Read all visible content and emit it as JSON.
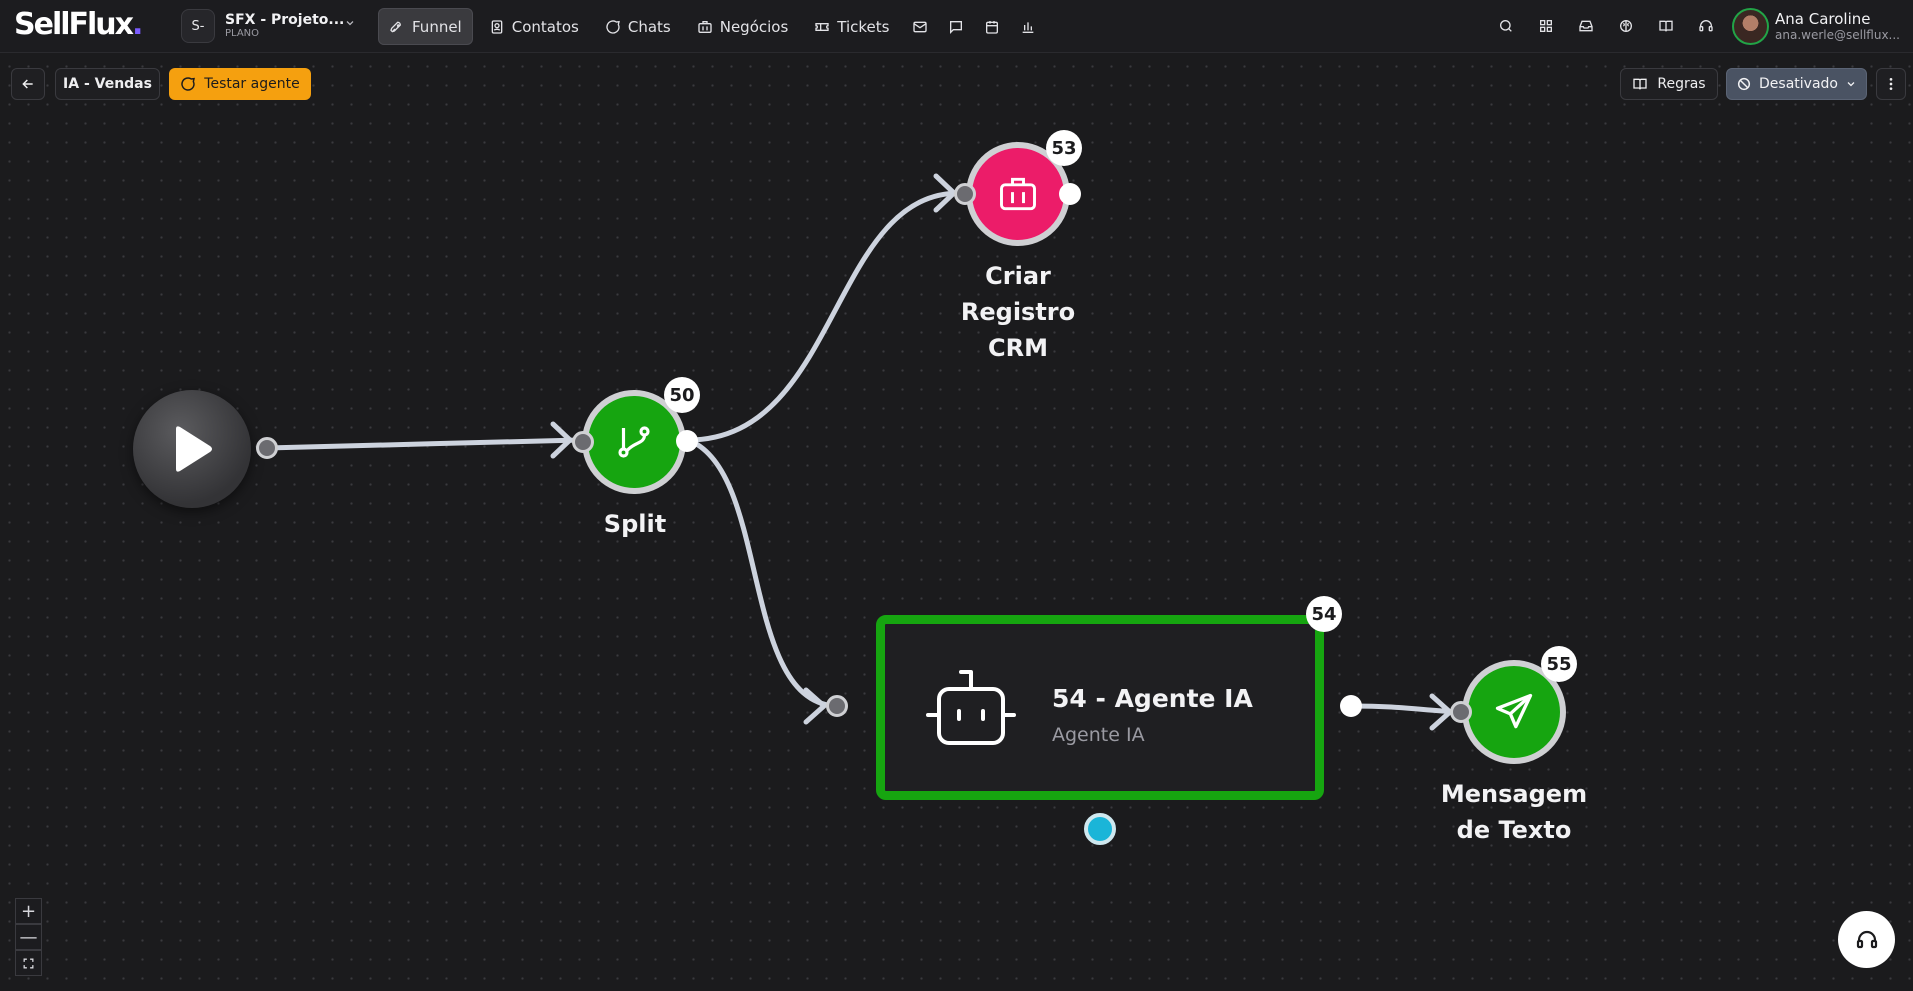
{
  "app": {
    "logo": "SellFlux",
    "logo_dot": "."
  },
  "project": {
    "badge": "S-",
    "name": "SFX - Projeto...",
    "plan": "PLANO"
  },
  "nav": {
    "items": [
      {
        "label": "Funnel",
        "icon": "rocket-icon",
        "active": true
      },
      {
        "label": "Contatos",
        "icon": "contacts-icon"
      },
      {
        "label": "Chats",
        "icon": "chat-bubble-icon"
      },
      {
        "label": "Negócios",
        "icon": "briefcase-icon"
      },
      {
        "label": "Tickets",
        "icon": "ticket-icon"
      }
    ],
    "icon_items": [
      "mail-icon",
      "message-square-icon",
      "calendar-icon",
      "bar-chart-icon"
    ]
  },
  "header_icons": [
    "search-icon",
    "apps-grid-icon",
    "inbox-icon",
    "brain-icon",
    "book-icon",
    "headset-icon"
  ],
  "user": {
    "name": "Ana Caroline",
    "email": "ana.werle@sellflux..."
  },
  "toolbar": {
    "flow_name": "IA - Vendas",
    "test_label": "Testar agente",
    "rules_label": "Regras",
    "status_label": "Desativado"
  },
  "nodes": {
    "split": {
      "number": "50",
      "label": "Split"
    },
    "crm": {
      "number": "53",
      "label_lines": [
        "Criar",
        "Registro",
        "CRM"
      ]
    },
    "agent": {
      "number": "54",
      "title": "54 - Agente IA",
      "subtitle": "Agente IA"
    },
    "message": {
      "number": "55",
      "label_lines": [
        "Mensagem",
        "de Texto"
      ]
    }
  },
  "zoom": {
    "in": "+",
    "out": "—",
    "fit": "⛶"
  },
  "colors": {
    "green": "#16a510",
    "pink": "#ec1c69",
    "orange": "#f5a00f",
    "cyan": "#1ab5d8",
    "status_bg": "#4a5363"
  }
}
